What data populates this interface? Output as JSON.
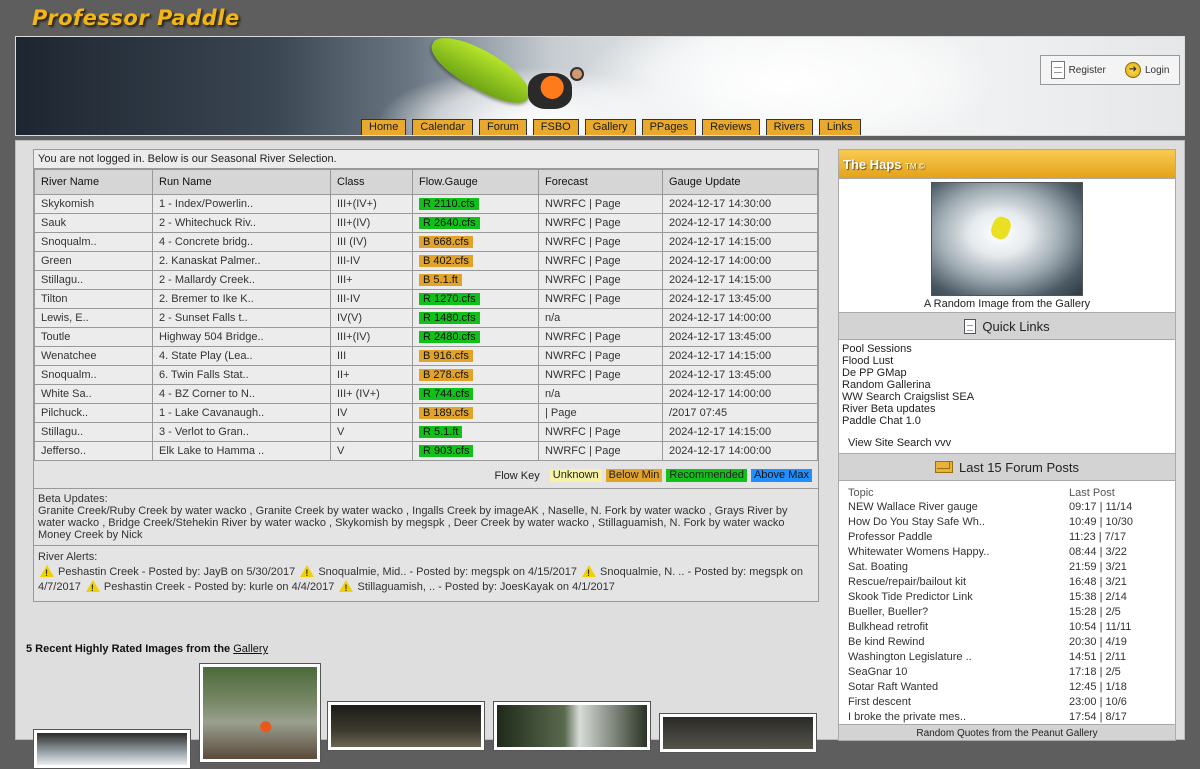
{
  "site": {
    "logo": "Professor Paddle"
  },
  "auth": {
    "register": "Register",
    "login": "Login"
  },
  "nav": [
    "Home",
    "Calendar",
    "Forum",
    "FSBO",
    "Gallery",
    "PPages",
    "Reviews",
    "Rivers",
    "Links"
  ],
  "rivers": {
    "notice": "You are not logged in. Below is our Seasonal River Selection.",
    "headers": [
      "River Name",
      "Run Name",
      "Class",
      "Flow.Gauge",
      "Forecast",
      "Gauge Update"
    ],
    "rows": [
      {
        "river": "Skykomish",
        "run": "1 - Index/Powerlin..",
        "class": "III+(IV+)",
        "flow": "R  2110.cfs",
        "status": "green",
        "forecast": "NWRFC | Page",
        "updated": "2024-12-17  14:30:00"
      },
      {
        "river": "Sauk",
        "run": "2 - Whitechuck Riv..",
        "class": "III+(IV)",
        "flow": "R  2640.cfs",
        "status": "green",
        "forecast": "NWRFC | Page",
        "updated": "2024-12-17  14:30:00"
      },
      {
        "river": "Snoqualm..",
        "run": "4 - Concrete bridg..",
        "class": "III (IV)",
        "flow": "B  668.cfs",
        "status": "orange",
        "forecast": "NWRFC | Page",
        "updated": "2024-12-17  14:15:00"
      },
      {
        "river": "Green",
        "run": "2. Kanaskat Palmer..",
        "class": "III-IV",
        "flow": "B  402.cfs",
        "status": "orange",
        "forecast": "NWRFC | Page",
        "updated": "2024-12-17  14:00:00"
      },
      {
        "river": "Stillagu..",
        "run": "2 - Mallardy Creek..",
        "class": "III+",
        "flow": "B  5.1.ft",
        "status": "orange",
        "forecast": "NWRFC | Page",
        "updated": "2024-12-17  14:15:00"
      },
      {
        "river": "Tilton",
        "run": "2. Bremer to Ike K..",
        "class": "III-IV",
        "flow": "R  1270.cfs",
        "status": "green",
        "forecast": "NWRFC | Page",
        "updated": "2024-12-17  13:45:00"
      },
      {
        "river": "Lewis, E..",
        "run": "2 - Sunset Falls t..",
        "class": "IV(V)",
        "flow": "R  1480.cfs",
        "status": "green",
        "forecast": "n/a",
        "updated": "2024-12-17  14:00:00"
      },
      {
        "river": "Toutle",
        "run": "Highway 504 Bridge..",
        "class": "III+(IV)",
        "flow": "R  2480.cfs",
        "status": "green",
        "forecast": "NWRFC | Page",
        "updated": "2024-12-17  13:45:00"
      },
      {
        "river": "Wenatchee",
        "run": "4. State Play (Lea..",
        "class": "III",
        "flow": "B  916.cfs",
        "status": "orange",
        "forecast": "NWRFC | Page",
        "updated": "2024-12-17  14:15:00"
      },
      {
        "river": "Snoqualm..",
        "run": "6. Twin Falls Stat..",
        "class": "II+",
        "flow": "B  278.cfs",
        "status": "orange",
        "forecast": "NWRFC | Page",
        "updated": "2024-12-17  13:45:00"
      },
      {
        "river": "White Sa..",
        "run": "4 - BZ Corner to N..",
        "class": "III+ (IV+)",
        "flow": "R  744.cfs",
        "status": "green",
        "forecast": "n/a",
        "updated": "2024-12-17  14:00:00"
      },
      {
        "river": "Pilchuck..",
        "run": "1 - Lake Cavanaugh..",
        "class": "IV",
        "flow": "B  189.cfs",
        "status": "orange",
        "forecast": "| Page",
        "updated": "/2017 07:45"
      },
      {
        "river": "Stillagu..",
        "run": "3 - Verlot to Gran..",
        "class": "V",
        "flow": "R  5.1.ft",
        "status": "green",
        "forecast": "NWRFC | Page",
        "updated": "2024-12-17  14:15:00"
      },
      {
        "river": "Jefferso..",
        "run": "Elk Lake to Hamma ..",
        "class": "V",
        "flow": "R  903.cfs",
        "status": "green",
        "forecast": "NWRFC | Page",
        "updated": "2024-12-17  14:00:00"
      }
    ],
    "flow_key": {
      "label": "Flow Key",
      "unknown": "Unknown",
      "below": "Below Min",
      "recommended": "Recommended",
      "above": "Above Max"
    },
    "beta_label": "Beta Updates:",
    "beta_text": "Granite Creek/Ruby Creek by water wacko , Granite Creek by water wacko , Ingalls Creek by imageAK , Naselle, N. Fork by water wacko , Grays River by water wacko , Bridge Creek/Stehekin River by water wacko , Skykomish by megspk , Deer Creek by water wacko , Stillaguamish, N. Fork by water wacko Money Creek by Nick",
    "alerts_label": "River Alerts:",
    "alerts": [
      "Peshastin Creek - Posted by: JayB on 5/30/2017",
      "Snoqualmie, Mid.. - Posted by: megspk on 4/15/2017",
      "Snoqualmie, N. .. - Posted by: megspk on 4/7/2017",
      "Peshastin Creek - Posted by: kurle on 4/4/2017",
      "Stillaguamish, .. - Posted by: JoesKayak on 4/1/2017"
    ]
  },
  "gallery": {
    "title": "5 Recent Highly Rated Images from the",
    "link": "Gallery"
  },
  "sidebar": {
    "haps_title": "The Haps",
    "haps_mark": "TM ©",
    "random_caption": "A Random Image from the Gallery",
    "quick_links_title": "Quick Links",
    "quick_links": [
      "Pool Sessions",
      "Flood Lust",
      "De PP GMap",
      "Random Gallerina",
      "WW Search Craigslist SEA",
      "River Beta updates",
      "Paddle Chat 1.0"
    ],
    "site_search": "View Site Search vvv",
    "forum_title": "Last 15 Forum Posts",
    "forum_headers": [
      "Topic",
      "Last Post"
    ],
    "posts": [
      {
        "topic": "NEW Wallace River gauge",
        "last": "09:17 | 11/14"
      },
      {
        "topic": "How Do You Stay Safe Wh..",
        "last": "10:49 | 10/30"
      },
      {
        "topic": "Professor Paddle",
        "last": "11:23 | 7/17"
      },
      {
        "topic": "Whitewater Womens Happy..",
        "last": "08:44 | 3/22"
      },
      {
        "topic": "Sat. Boating",
        "last": "21:59 | 3/21"
      },
      {
        "topic": "Rescue/repair/bailout kit",
        "last": "16:48 | 3/21"
      },
      {
        "topic": "Skook Tide Predictor Link",
        "last": "15:38 | 2/14"
      },
      {
        "topic": "Bueller, Bueller?",
        "last": "15:28 | 2/5"
      },
      {
        "topic": "Bulkhead retrofit",
        "last": "10:54 | 11/11"
      },
      {
        "topic": "Be kind Rewind",
        "last": "20:30 | 4/19"
      },
      {
        "topic": "Washington Legislature ..",
        "last": "14:51 | 2/11"
      },
      {
        "topic": "SeaGnar 10",
        "last": "17:18 | 2/5"
      },
      {
        "topic": "Sotar Raft Wanted",
        "last": "12:45 | 1/18"
      },
      {
        "topic": "First descent",
        "last": "23:00 | 10/6"
      },
      {
        "topic": "I broke the private mes..",
        "last": "17:54 | 8/17"
      }
    ],
    "quotes_title": "Random Quotes from the Peanut Gallery"
  }
}
